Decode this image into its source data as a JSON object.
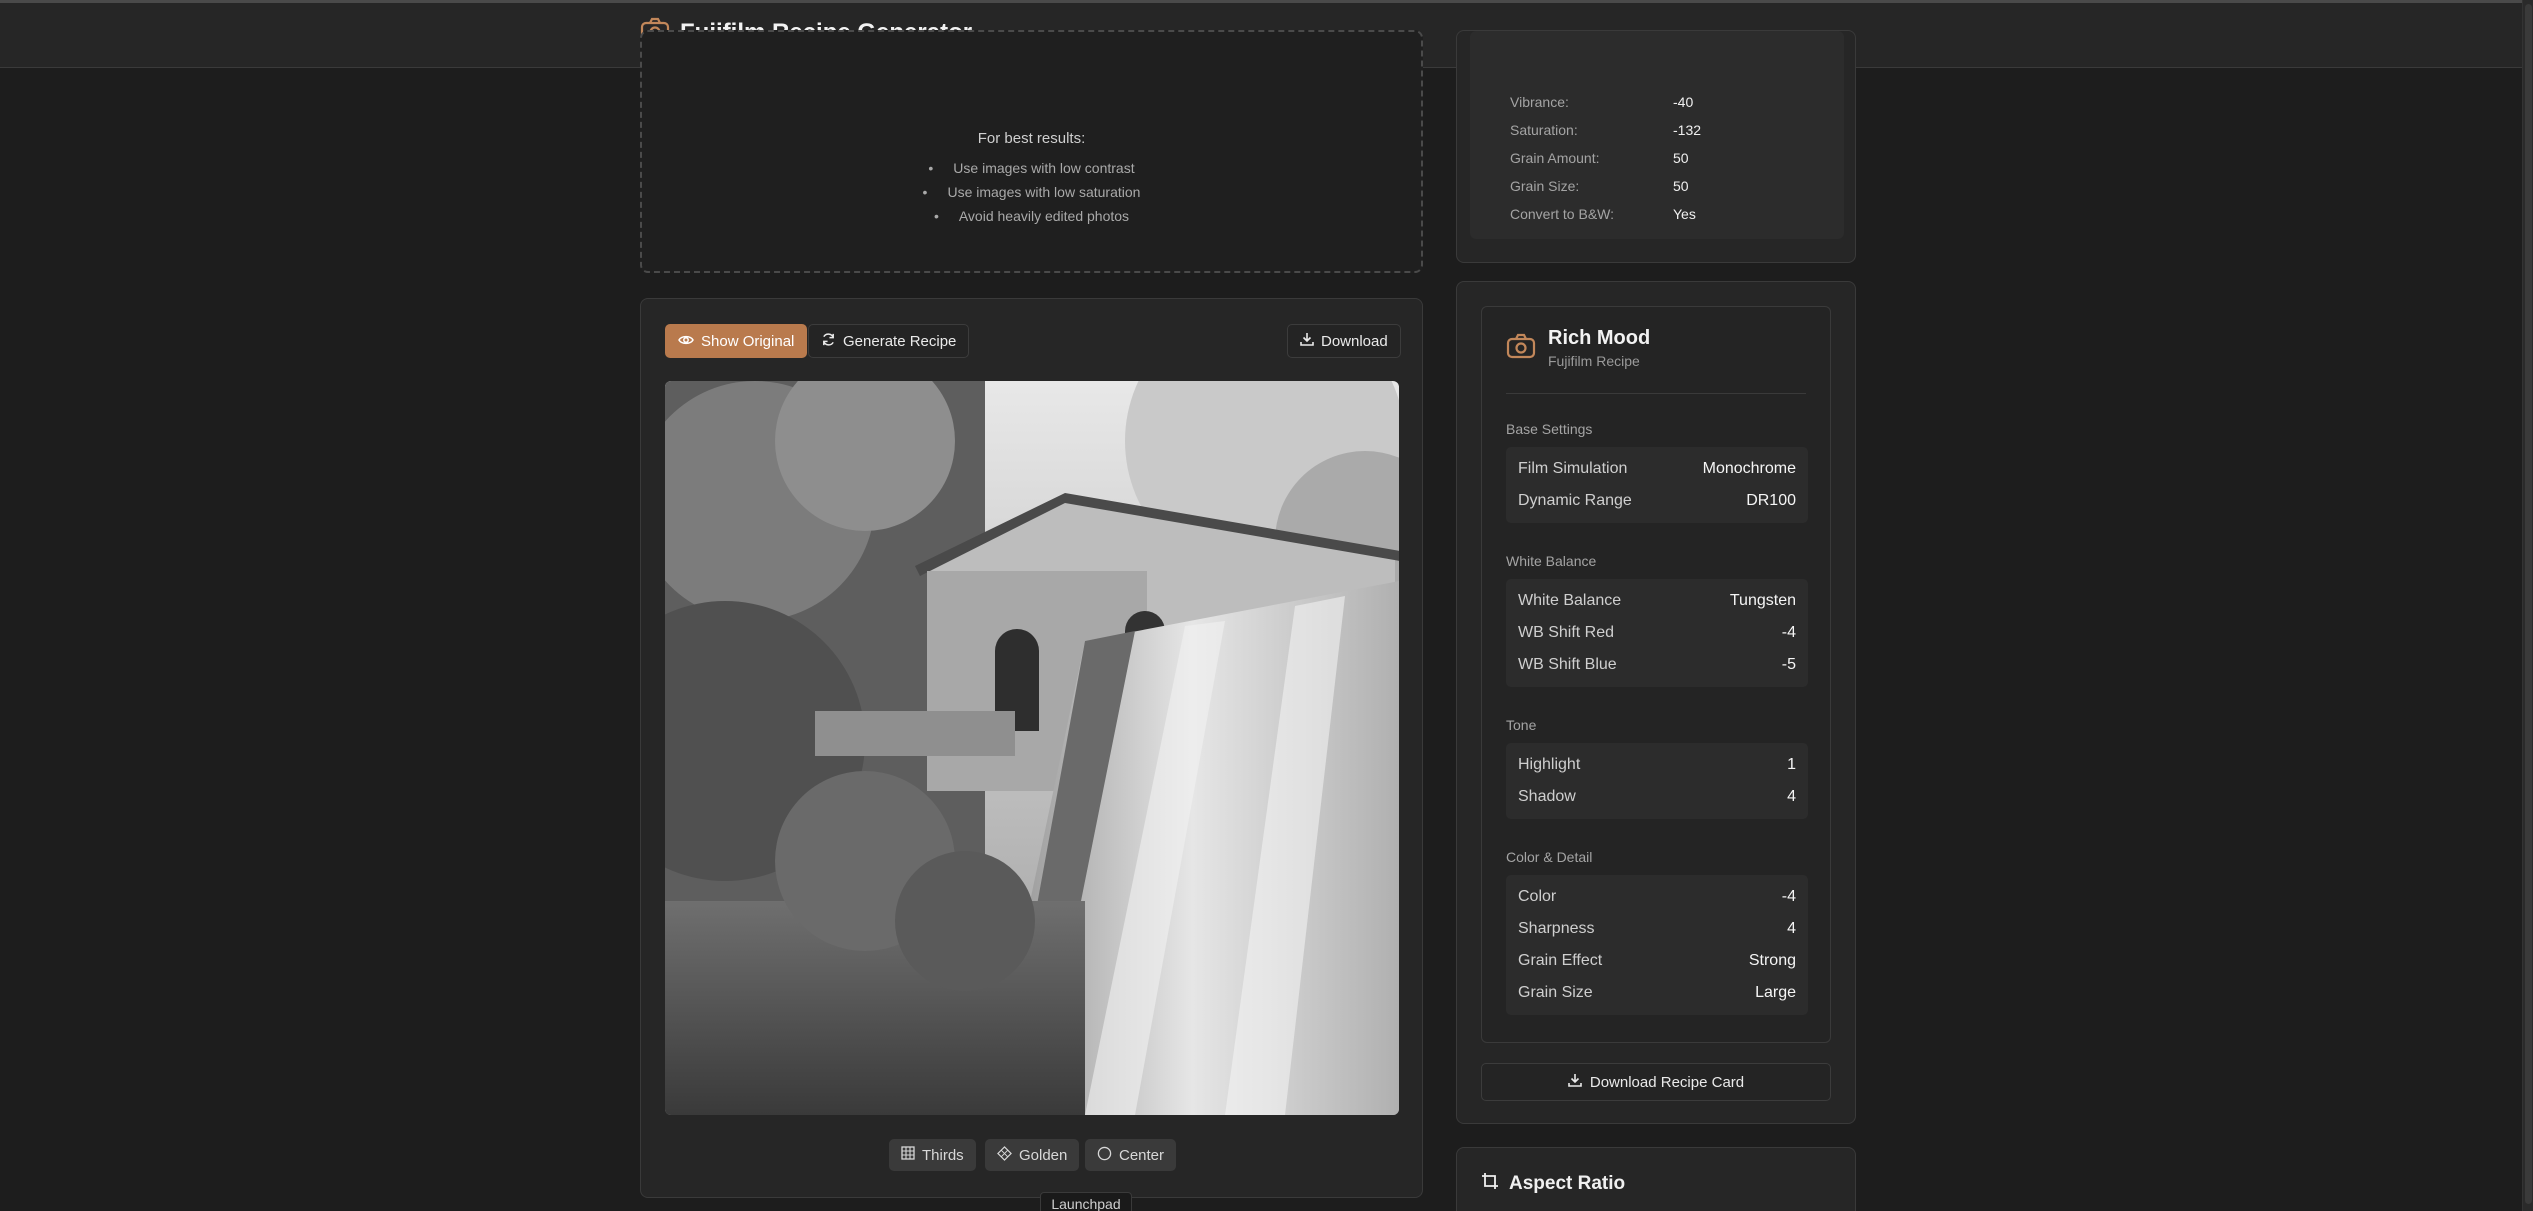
{
  "header": {
    "title": "Fujifilm Recipe Generator",
    "icon": "camera-icon",
    "accent": "#c2875a"
  },
  "upload": {
    "tips_title": "For best results:",
    "tips": [
      "Use images with low contrast",
      "Use images with low saturation",
      "Avoid heavily edited photos"
    ]
  },
  "editor": {
    "show_original_label": "Show Original",
    "generate_label": "Generate Recipe",
    "download_label": "Download",
    "grid_options": [
      "Thirds",
      "Golden",
      "Center"
    ],
    "tooltip": "Launchpad"
  },
  "settings": [
    {
      "label": "Vibrance:",
      "value": "-40"
    },
    {
      "label": "Saturation:",
      "value": "-132"
    },
    {
      "label": "Grain Amount:",
      "value": "50"
    },
    {
      "label": "Grain Size:",
      "value": "50"
    },
    {
      "label": "Convert to B&W:",
      "value": "Yes"
    }
  ],
  "recipe": {
    "name": "Rich Mood",
    "subtitle": "Fujifilm Recipe",
    "base_label": "Base Settings",
    "base": [
      {
        "k": "Film Simulation",
        "v": "Monochrome"
      },
      {
        "k": "Dynamic Range",
        "v": "DR100"
      }
    ],
    "wb_label": "White Balance",
    "wb": [
      {
        "k": "White Balance",
        "v": "Tungsten"
      },
      {
        "k": "WB Shift Red",
        "v": "-4"
      },
      {
        "k": "WB Shift Blue",
        "v": "-5"
      }
    ],
    "tone_label": "Tone",
    "tone": [
      {
        "k": "Highlight",
        "v": "1"
      },
      {
        "k": "Shadow",
        "v": "4"
      }
    ],
    "color_label": "Color & Detail",
    "color": [
      {
        "k": "Color",
        "v": "-4"
      },
      {
        "k": "Sharpness",
        "v": "4"
      },
      {
        "k": "Grain Effect",
        "v": "Strong"
      },
      {
        "k": "Grain Size",
        "v": "Large"
      }
    ],
    "download_card_label": "Download Recipe Card"
  },
  "aspect": {
    "title": "Aspect Ratio"
  }
}
